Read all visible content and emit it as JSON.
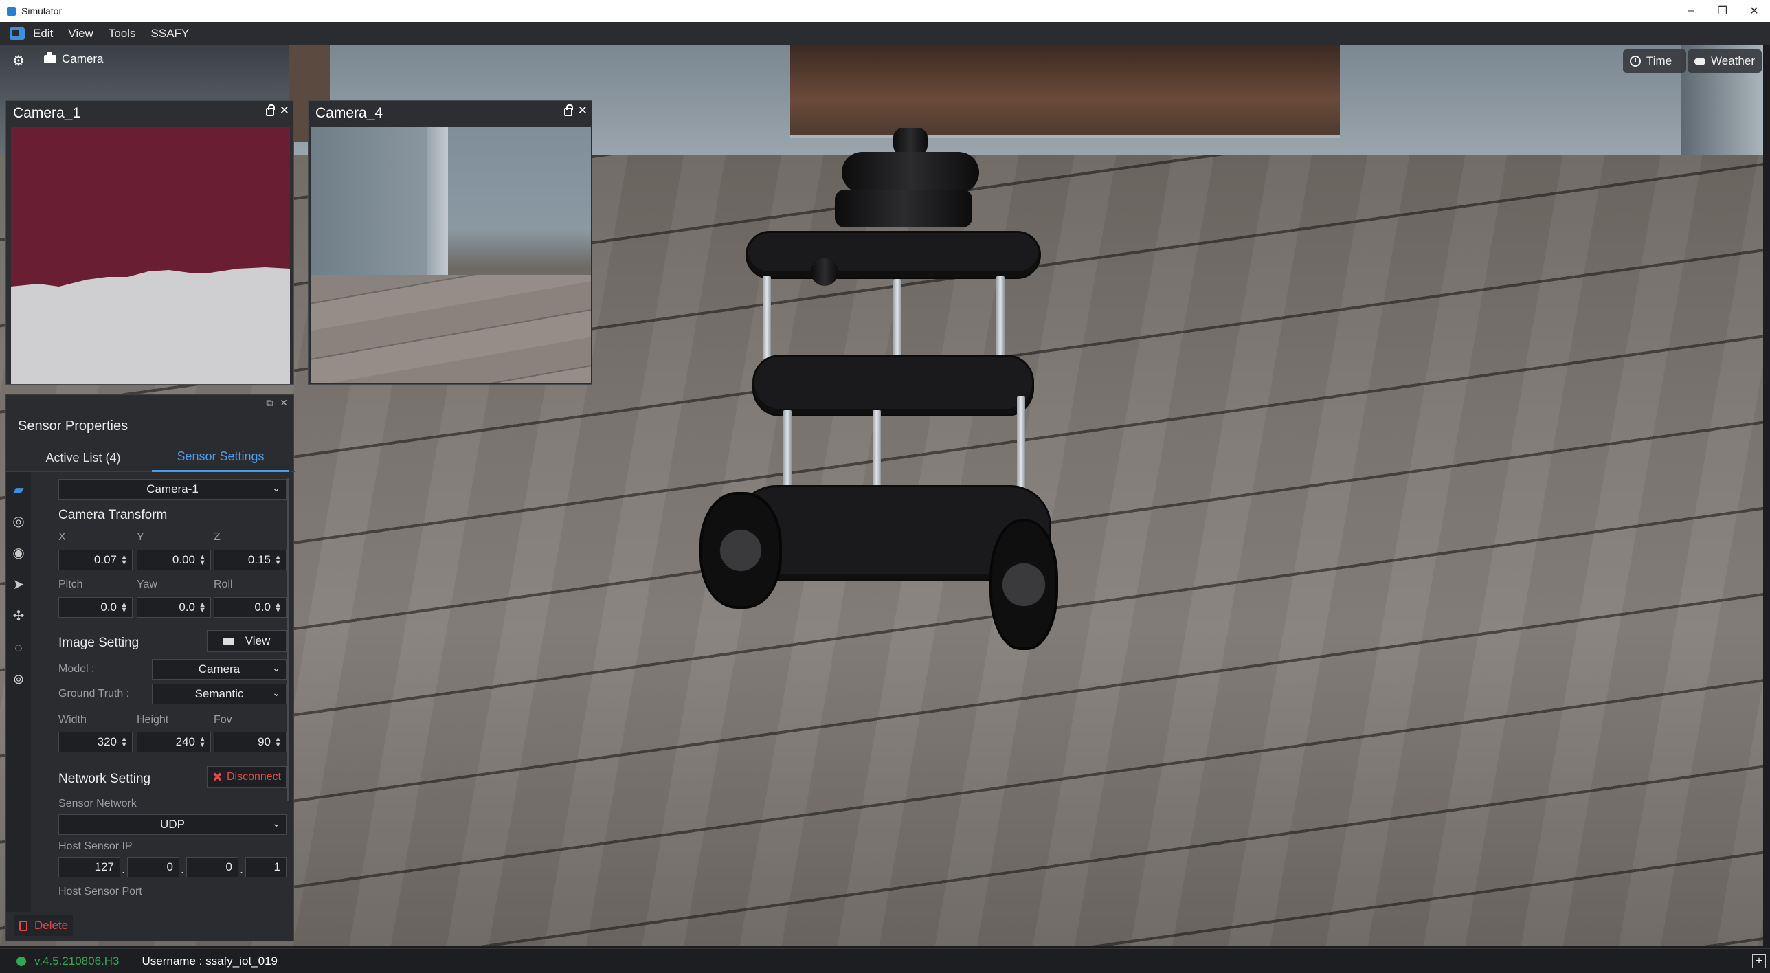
{
  "window": {
    "title": "Simulator",
    "controls": [
      "–",
      "❐",
      "✕"
    ]
  },
  "menu": {
    "items": [
      "Edit",
      "View",
      "Tools",
      "SSAFY"
    ]
  },
  "viewport": {
    "camera_label": "Camera",
    "time_label": "Time",
    "weather_label": "Weather"
  },
  "camera_panels": [
    {
      "title": "Camera_1"
    },
    {
      "title": "Camera_4"
    }
  ],
  "sensor_properties": {
    "title": "Sensor Properties",
    "tabs": [
      "Active List (4)",
      "Sensor Settings"
    ],
    "active_tab": "Sensor Settings",
    "rail_icons": [
      "camera-icon",
      "lidar-icon",
      "radio-icon",
      "navigation-icon",
      "imu-icon",
      "radar-icon",
      "signal-icon"
    ],
    "sensor_select": "Camera-1",
    "camera_transform": {
      "heading": "Camera Transform",
      "labels": [
        "X",
        "Y",
        "Z"
      ],
      "values": [
        "0.07",
        "0.00",
        "0.15"
      ],
      "rot_labels": [
        "Pitch",
        "Yaw",
        "Roll"
      ],
      "rot_values": [
        "0.0",
        "0.0",
        "0.0"
      ]
    },
    "image_setting": {
      "heading": "Image Setting",
      "view_label": "View",
      "model_label": "Model :",
      "model_value": "Camera",
      "ground_truth_label": "Ground Truth :",
      "ground_truth_value": "Semantic",
      "dim_labels": [
        "Width",
        "Height",
        "Fov"
      ],
      "dim_values": [
        "320",
        "240",
        "90"
      ]
    },
    "network_setting": {
      "heading": "Network Setting",
      "disconnect_label": "Disconnect",
      "sensor_network_label": "Sensor Network",
      "sensor_network_value": "UDP",
      "host_ip_label": "Host Sensor IP",
      "host_ip": [
        "127",
        "0",
        "0",
        "1"
      ],
      "host_port_label": "Host Sensor Port"
    },
    "delete_label": "Delete"
  },
  "status": {
    "version": "v.4.5.210806.H3",
    "username": "Username : ssafy_iot_019"
  }
}
